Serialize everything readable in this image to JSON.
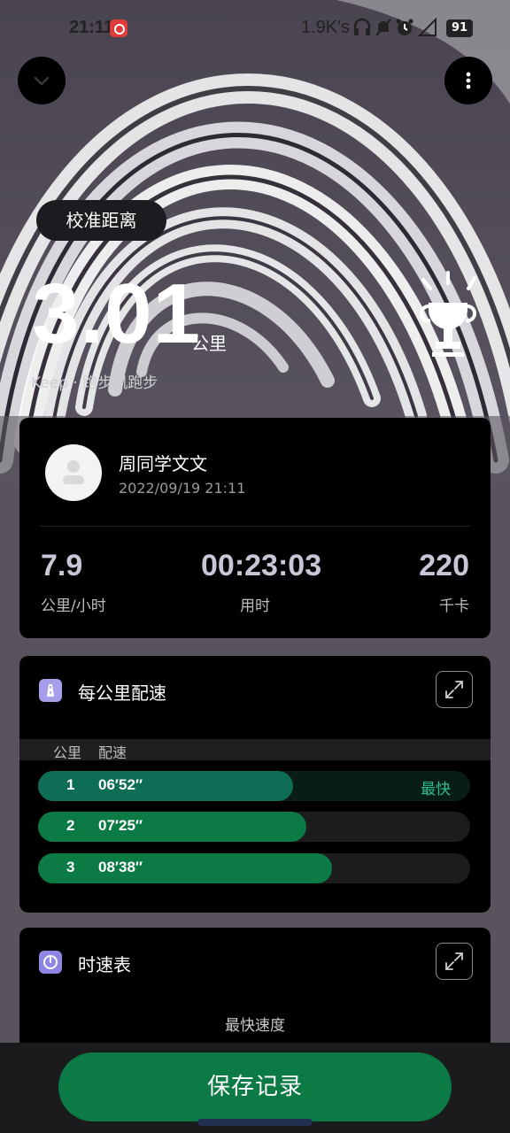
{
  "status_bar": {
    "time": "21:11",
    "net_speed": "1.9K's",
    "battery": "91",
    "icons": [
      "netease-music-icon",
      "headphone-icon",
      "mute-bell-icon",
      "alarm-icon",
      "signal-icon",
      "battery-icon"
    ]
  },
  "header": {
    "collapse_icon": "chevron-down-icon",
    "more_icon": "more-vertical-icon"
  },
  "hero": {
    "calibrate_label": "校准距离",
    "distance": "3.01",
    "unit": "公里",
    "source": "Keep · 跑步机跑步",
    "badge_icon": "trophy-icon"
  },
  "user": {
    "name": "周同学文文",
    "date": "2022/09/19 21:11"
  },
  "stats": [
    {
      "value": "7.9",
      "label": "公里/小时"
    },
    {
      "value": "00:23:03",
      "label": "用时"
    },
    {
      "value": "220",
      "label": "千卡"
    }
  ],
  "pace": {
    "title": "每公里配速",
    "col_km": "公里",
    "col_pace": "配速",
    "rows": [
      {
        "km": "1",
        "pace": "06′52″",
        "tag": "最快",
        "fraction": 0.59
      },
      {
        "km": "2",
        "pace": "07′25″",
        "tag": "",
        "fraction": 0.62
      },
      {
        "km": "3",
        "pace": "08′38″",
        "tag": "",
        "fraction": 0.68
      }
    ]
  },
  "speedometer": {
    "title": "时速表",
    "fastest_label": "最快速度"
  },
  "actions": {
    "save_label": "保存记录"
  },
  "colors": {
    "accent_green": "#0c7a45",
    "fastest_green": "#2fbf8f",
    "icon_purple": "#a69ee9"
  }
}
